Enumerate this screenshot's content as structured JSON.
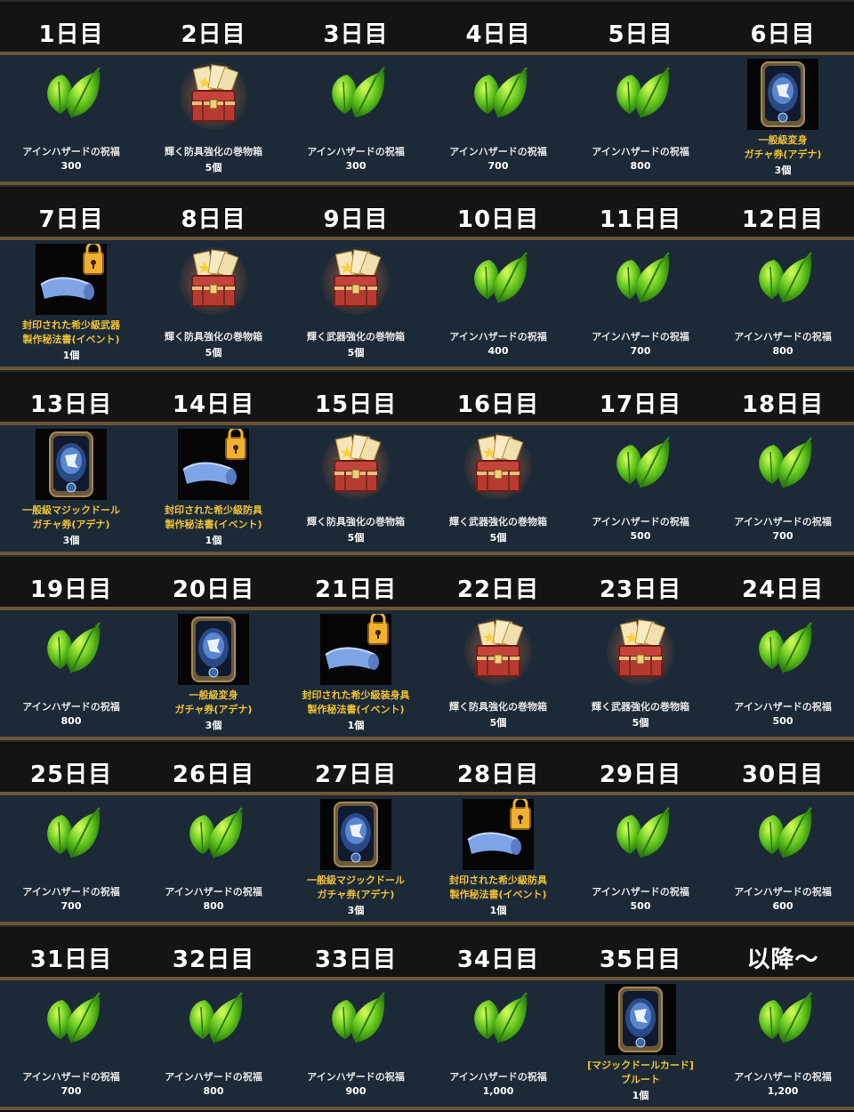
{
  "colors": {
    "gold_text": "#f1c232",
    "normal_text": "#e6e6e6",
    "row_bg": "#1c2a38",
    "header_bg": "#141414",
    "separator": "#6b5636"
  },
  "rows": [
    [
      {
        "day": "1日目",
        "icon": "leaf-icon",
        "lines": [
          "アインハザードの祝福"
        ],
        "qty": "300",
        "gold": false
      },
      {
        "day": "2日目",
        "icon": "chest-icon",
        "lines": [
          "輝く防具強化の巻物箱"
        ],
        "qty": "5個",
        "gold": false
      },
      {
        "day": "3日目",
        "icon": "leaf-icon",
        "lines": [
          "アインハザードの祝福"
        ],
        "qty": "300",
        "gold": false
      },
      {
        "day": "4日目",
        "icon": "leaf-icon",
        "lines": [
          "アインハザードの祝福"
        ],
        "qty": "700",
        "gold": false
      },
      {
        "day": "5日目",
        "icon": "leaf-icon",
        "lines": [
          "アインハザードの祝福"
        ],
        "qty": "800",
        "gold": false
      },
      {
        "day": "6日目",
        "icon": "card-icon",
        "lines": [
          "一般級変身",
          "ガチャ券(アデナ)"
        ],
        "qty": "3個",
        "gold": true
      }
    ],
    [
      {
        "day": "7日目",
        "icon": "scroll-lock-icon",
        "lines": [
          "封印された希少級武器",
          "製作秘法書(イベント)"
        ],
        "qty": "1個",
        "gold": true
      },
      {
        "day": "8日目",
        "icon": "chest-icon",
        "lines": [
          "輝く防具強化の巻物箱"
        ],
        "qty": "5個",
        "gold": false
      },
      {
        "day": "9日目",
        "icon": "chest-icon",
        "lines": [
          "輝く武器強化の巻物箱"
        ],
        "qty": "5個",
        "gold": false
      },
      {
        "day": "10日目",
        "icon": "leaf-icon",
        "lines": [
          "アインハザードの祝福"
        ],
        "qty": "400",
        "gold": false
      },
      {
        "day": "11日目",
        "icon": "leaf-icon",
        "lines": [
          "アインハザードの祝福"
        ],
        "qty": "700",
        "gold": false
      },
      {
        "day": "12日目",
        "icon": "leaf-icon",
        "lines": [
          "アインハザードの祝福"
        ],
        "qty": "800",
        "gold": false
      }
    ],
    [
      {
        "day": "13日目",
        "icon": "card-icon",
        "lines": [
          "一般級マジックドール",
          "ガチャ券(アデナ)"
        ],
        "qty": "3個",
        "gold": true
      },
      {
        "day": "14日目",
        "icon": "scroll-lock-icon",
        "lines": [
          "封印された希少級防具",
          "製作秘法書(イベント)"
        ],
        "qty": "1個",
        "gold": true
      },
      {
        "day": "15日目",
        "icon": "chest-icon",
        "lines": [
          "輝く防具強化の巻物箱"
        ],
        "qty": "5個",
        "gold": false
      },
      {
        "day": "16日目",
        "icon": "chest-icon",
        "lines": [
          "輝く武器強化の巻物箱"
        ],
        "qty": "5個",
        "gold": false
      },
      {
        "day": "17日目",
        "icon": "leaf-icon",
        "lines": [
          "アインハザードの祝福"
        ],
        "qty": "500",
        "gold": false
      },
      {
        "day": "18日目",
        "icon": "leaf-icon",
        "lines": [
          "アインハザードの祝福"
        ],
        "qty": "700",
        "gold": false
      }
    ],
    [
      {
        "day": "19日目",
        "icon": "leaf-icon",
        "lines": [
          "アインハザードの祝福"
        ],
        "qty": "800",
        "gold": false
      },
      {
        "day": "20日目",
        "icon": "card-icon",
        "lines": [
          "一般級変身",
          "ガチャ券(アデナ)"
        ],
        "qty": "3個",
        "gold": true
      },
      {
        "day": "21日目",
        "icon": "scroll-lock-icon",
        "lines": [
          "封印された希少級装身具",
          "製作秘法書(イベント)"
        ],
        "qty": "1個",
        "gold": true
      },
      {
        "day": "22日目",
        "icon": "chest-icon",
        "lines": [
          "輝く防具強化の巻物箱"
        ],
        "qty": "5個",
        "gold": false
      },
      {
        "day": "23日目",
        "icon": "chest-icon",
        "lines": [
          "輝く武器強化の巻物箱"
        ],
        "qty": "5個",
        "gold": false
      },
      {
        "day": "24日目",
        "icon": "leaf-icon",
        "lines": [
          "アインハザードの祝福"
        ],
        "qty": "500",
        "gold": false
      }
    ],
    [
      {
        "day": "25日目",
        "icon": "leaf-icon",
        "lines": [
          "アインハザードの祝福"
        ],
        "qty": "700",
        "gold": false
      },
      {
        "day": "26日目",
        "icon": "leaf-icon",
        "lines": [
          "アインハザードの祝福"
        ],
        "qty": "800",
        "gold": false
      },
      {
        "day": "27日目",
        "icon": "card-icon",
        "lines": [
          "一般級マジックドール",
          "ガチャ券(アデナ)"
        ],
        "qty": "3個",
        "gold": true
      },
      {
        "day": "28日目",
        "icon": "scroll-lock-icon",
        "lines": [
          "封印された希少級防具",
          "製作秘法書(イベント)"
        ],
        "qty": "1個",
        "gold": true
      },
      {
        "day": "29日目",
        "icon": "leaf-icon",
        "lines": [
          "アインハザードの祝福"
        ],
        "qty": "500",
        "gold": false
      },
      {
        "day": "30日目",
        "icon": "leaf-icon",
        "lines": [
          "アインハザードの祝福"
        ],
        "qty": "600",
        "gold": false
      }
    ],
    [
      {
        "day": "31日目",
        "icon": "leaf-icon",
        "lines": [
          "アインハザードの祝福"
        ],
        "qty": "700",
        "gold": false
      },
      {
        "day": "32日目",
        "icon": "leaf-icon",
        "lines": [
          "アインハザードの祝福"
        ],
        "qty": "800",
        "gold": false
      },
      {
        "day": "33日目",
        "icon": "leaf-icon",
        "lines": [
          "アインハザードの祝福"
        ],
        "qty": "900",
        "gold": false
      },
      {
        "day": "34日目",
        "icon": "leaf-icon",
        "lines": [
          "アインハザードの祝福"
        ],
        "qty": "1,000",
        "gold": false
      },
      {
        "day": "35日目",
        "icon": "card-icon",
        "lines": [
          "[マジックドールカード]",
          "ブルート"
        ],
        "qty": "1個",
        "gold": true
      },
      {
        "day": "以降～",
        "icon": "leaf-icon",
        "lines": [
          "アインハザードの祝福"
        ],
        "qty": "1,200",
        "gold": false
      }
    ]
  ]
}
